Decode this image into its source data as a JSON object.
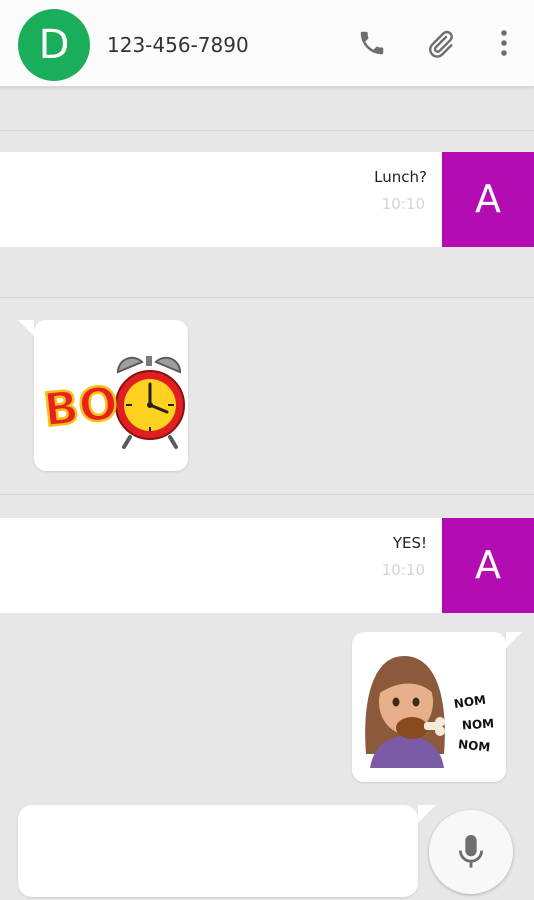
{
  "header": {
    "avatar_letter": "D",
    "phone_number": "123-456-7890",
    "icons": [
      "phone-icon",
      "paperclip-icon",
      "more-vert-icon"
    ]
  },
  "messages": [
    {
      "direction": "outgoing",
      "text": "Lunch?",
      "time": "10:10",
      "avatar_letter": "A"
    },
    {
      "direction": "incoming",
      "sticker": "boo-alarm-clock-sticker"
    },
    {
      "direction": "outgoing",
      "text": "YES!",
      "time": "10:10",
      "avatar_letter": "A"
    },
    {
      "direction": "outgoing",
      "sticker": "nom-nom-sticker",
      "sticker_text": [
        "NOM",
        "NOM",
        "NOM"
      ]
    }
  ],
  "sticker_boo": {
    "letters": "BO"
  },
  "composer": {
    "placeholder": "",
    "mic_icon": "microphone-icon"
  },
  "colors": {
    "contact_avatar": "#1aad5a",
    "self_avatar": "#b30cb3",
    "background": "#e7e7e7"
  }
}
